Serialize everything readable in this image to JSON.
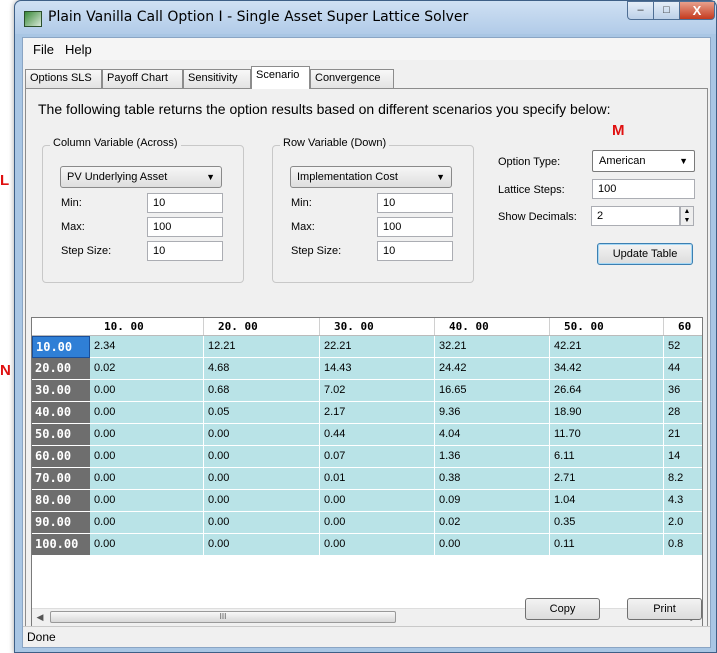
{
  "annotations": {
    "left_l": "L",
    "left_n": "N",
    "m_marker": "M"
  },
  "window": {
    "title": "Plain Vanilla Call Option I - Single Asset Super Lattice Solver",
    "controls": {
      "minimize": "–",
      "maximize": "□",
      "close": "X"
    }
  },
  "menu": [
    "File",
    "Help"
  ],
  "tabs": [
    {
      "label": "Options SLS",
      "active": false
    },
    {
      "label": "Payoff Chart",
      "active": false
    },
    {
      "label": "Sensitivity",
      "active": false
    },
    {
      "label": "Scenario",
      "active": true
    },
    {
      "label": "Convergence",
      "active": false
    }
  ],
  "description": "The following table returns the option results based on different scenarios you specify below:",
  "column_variable": {
    "title": "Column Variable (Across)",
    "selected": "PV Underlying Asset",
    "min_label": "Min:",
    "min": "10",
    "max_label": "Max:",
    "max": "100",
    "step_label": "Step Size:",
    "step": "10"
  },
  "row_variable": {
    "title": "Row Variable (Down)",
    "selected": "Implementation Cost",
    "min_label": "Min:",
    "min": "10",
    "max_label": "Max:",
    "max": "100",
    "step_label": "Step Size:",
    "step": "10"
  },
  "options": {
    "option_type_label": "Option Type:",
    "option_type": "American",
    "lattice_steps_label": "Lattice Steps:",
    "lattice_steps": "100",
    "show_decimals_label": "Show Decimals:",
    "show_decimals": "2",
    "update_button": "Update Table"
  },
  "table": {
    "column_headers": [
      "10. 00",
      "20. 00",
      "30. 00",
      "40. 00",
      "50. 00",
      "60"
    ],
    "rows": [
      {
        "header": "10.00",
        "cells": [
          "2.34",
          "12.21",
          "22.21",
          "32.21",
          "42.21",
          "52"
        ]
      },
      {
        "header": "20.00",
        "cells": [
          "0.02",
          "4.68",
          "14.43",
          "24.42",
          "34.42",
          "44"
        ]
      },
      {
        "header": "30.00",
        "cells": [
          "0.00",
          "0.68",
          "7.02",
          "16.65",
          "26.64",
          "36"
        ]
      },
      {
        "header": "40.00",
        "cells": [
          "0.00",
          "0.05",
          "2.17",
          "9.36",
          "18.90",
          "28"
        ]
      },
      {
        "header": "50.00",
        "cells": [
          "0.00",
          "0.00",
          "0.44",
          "4.04",
          "11.70",
          "21"
        ]
      },
      {
        "header": "60.00",
        "cells": [
          "0.00",
          "0.00",
          "0.07",
          "1.36",
          "6.11",
          "14"
        ]
      },
      {
        "header": "70.00",
        "cells": [
          "0.00",
          "0.00",
          "0.01",
          "0.38",
          "2.71",
          "8.2"
        ]
      },
      {
        "header": "80.00",
        "cells": [
          "0.00",
          "0.00",
          "0.00",
          "0.09",
          "1.04",
          "4.3"
        ]
      },
      {
        "header": "90.00",
        "cells": [
          "0.00",
          "0.00",
          "0.00",
          "0.02",
          "0.35",
          "2.0"
        ]
      },
      {
        "header": "100.00",
        "cells": [
          "0.00",
          "0.00",
          "0.00",
          "0.00",
          "0.11",
          "0.8"
        ]
      }
    ],
    "selected_row": "10.00"
  },
  "buttons": {
    "copy": "Copy",
    "print": "Print"
  },
  "status": "Done",
  "icons": {
    "app": "lattice-app-icon",
    "dropdown": "▼",
    "scroll_left": "◀",
    "scroll_right": "▶"
  }
}
